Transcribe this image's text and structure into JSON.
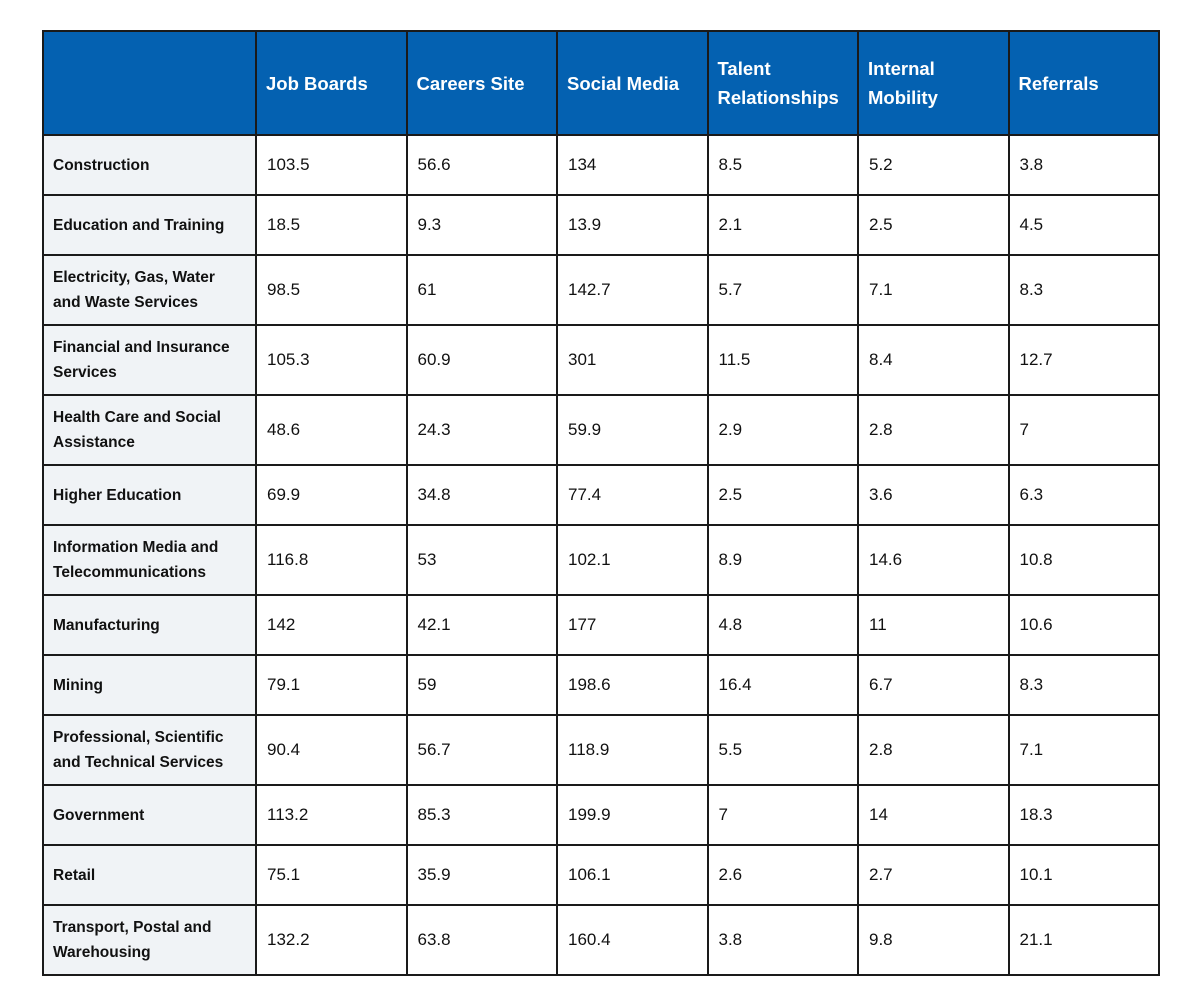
{
  "chart_data": {
    "type": "table",
    "title": "",
    "columns": [
      "",
      "Job Boards",
      "Careers Site",
      "Social Media",
      "Talent Relationships",
      "Internal Mobility",
      "Referrals"
    ],
    "series": [
      {
        "name": "Job Boards",
        "values": [
          103.5,
          18.5,
          98.5,
          105.3,
          48.6,
          69.9,
          116.8,
          142,
          79.1,
          90.4,
          113.2,
          75.1,
          132.2
        ]
      },
      {
        "name": "Careers Site",
        "values": [
          56.6,
          9.3,
          61,
          60.9,
          24.3,
          34.8,
          53,
          42.1,
          59,
          56.7,
          85.3,
          35.9,
          63.8
        ]
      },
      {
        "name": "Social Media",
        "values": [
          134,
          13.9,
          142.7,
          301,
          59.9,
          77.4,
          102.1,
          177,
          198.6,
          118.9,
          199.9,
          106.1,
          160.4
        ]
      },
      {
        "name": "Talent Relationships",
        "values": [
          8.5,
          2.1,
          5.7,
          11.5,
          2.9,
          2.5,
          8.9,
          4.8,
          16.4,
          5.5,
          7,
          2.6,
          3.8
        ]
      },
      {
        "name": "Internal Mobility",
        "values": [
          5.2,
          2.5,
          7.1,
          8.4,
          2.8,
          3.6,
          14.6,
          11,
          6.7,
          2.8,
          14,
          2.7,
          9.8
        ]
      },
      {
        "name": "Referrals",
        "values": [
          3.8,
          4.5,
          8.3,
          12.7,
          7,
          6.3,
          10.8,
          10.6,
          8.3,
          7.1,
          18.3,
          10.1,
          21.1
        ]
      }
    ],
    "header_color": "#0461b1",
    "row_header_color": "#f0f3f6",
    "rows": [
      {
        "label": "Construction",
        "cells": [
          "103.5",
          "56.6",
          "134",
          "8.5",
          "5.2",
          "3.8"
        ]
      },
      {
        "label": "Education and Training",
        "cells": [
          "18.5",
          "9.3",
          "13.9",
          "2.1",
          "2.5",
          "4.5"
        ]
      },
      {
        "label": "Electricity, Gas, Water and Waste Services",
        "cells": [
          "98.5",
          "61",
          "142.7",
          "5.7",
          "7.1",
          "8.3"
        ]
      },
      {
        "label": "Financial and Insurance Services",
        "cells": [
          "105.3",
          "60.9",
          "301",
          "11.5",
          "8.4",
          "12.7"
        ]
      },
      {
        "label": "Health Care and Social Assistance",
        "cells": [
          "48.6",
          "24.3",
          "59.9",
          "2.9",
          "2.8",
          "7"
        ]
      },
      {
        "label": "Higher Education",
        "cells": [
          "69.9",
          "34.8",
          "77.4",
          "2.5",
          "3.6",
          "6.3"
        ]
      },
      {
        "label": "Information Media and Telecommunications",
        "cells": [
          "116.8",
          "53",
          "102.1",
          "8.9",
          "14.6",
          "10.8"
        ]
      },
      {
        "label": "Manufacturing",
        "cells": [
          "142",
          "42.1",
          "177",
          "4.8",
          "11",
          "10.6"
        ]
      },
      {
        "label": "Mining",
        "cells": [
          "79.1",
          "59",
          "198.6",
          "16.4",
          "6.7",
          "8.3"
        ]
      },
      {
        "label": "Professional, Scientific and Technical Services",
        "cells": [
          "90.4",
          "56.7",
          "118.9",
          "5.5",
          "2.8",
          "7.1"
        ]
      },
      {
        "label": "Government",
        "cells": [
          "113.2",
          "85.3",
          "199.9",
          "7",
          "14",
          "18.3"
        ]
      },
      {
        "label": "Retail",
        "cells": [
          "75.1",
          "35.9",
          "106.1",
          "2.6",
          "2.7",
          "10.1"
        ]
      },
      {
        "label": "Transport, Postal and Warehousing",
        "cells": [
          "132.2",
          "63.8",
          "160.4",
          "3.8",
          "9.8",
          "21.1"
        ]
      }
    ]
  }
}
